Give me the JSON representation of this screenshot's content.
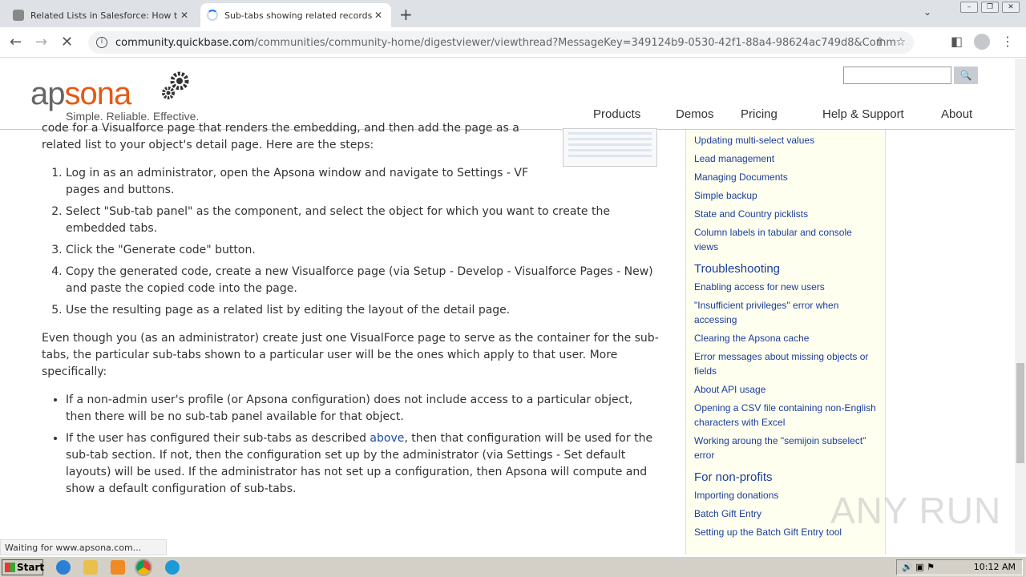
{
  "browser": {
    "tabs": [
      {
        "title": "Related Lists in Salesforce: How to S",
        "active": false
      },
      {
        "title": "Sub-tabs showing related records - /",
        "active": true
      }
    ],
    "url_host": "community.quickbase.com",
    "url_path": "/communities/community-home/digestviewer/viewthread?MessageKey=349124b9-0530-42f1-88a4-98624ac749d8&Communit..."
  },
  "site": {
    "logo_ap": "ap",
    "logo_sona": "sona",
    "tagline": "Simple. Reliable. Effective.",
    "nav": [
      "Products",
      "Demos",
      "Pricing",
      "Help & Support",
      "About"
    ]
  },
  "content": {
    "intro": "code for a Visualforce page that renders the embedding, and then add the page as a related list to your object's detail page. Here are the steps:",
    "steps": [
      "Log in as an administrator, open the Apsona window and navigate to Settings - VF pages and buttons.",
      "Select \"Sub-tab panel\" as the component, and select the object for which you want to create the embedded tabs.",
      "Click the \"Generate code\" button.",
      "Copy the generated code, create a new Visualforce page (via Setup - Develop - Visualforce Pages - New) and paste the copied code into the page.",
      "Use the resulting page as a related list by editing the layout of the detail page."
    ],
    "para2": "Even though you (as an administrator) create just one VisualForce page to serve as the container for the sub-tabs, the particular sub-tabs shown to a particular user will be the ones which apply to that user. More specifically:",
    "bullet1": "If a non-admin user's profile (or Apsona configuration) does not include access to a particular object, then there will be no sub-tab panel available for that object.",
    "bullet2_pre": "If the user has configured their sub-tabs as described ",
    "bullet2_link": "above",
    "bullet2_post": ", then that configuration will be used for the sub-tab section. If not, then the configuration set up by the administrator (via Settings - Set default layouts) will be used. If the administrator has not set up a configuration, then Apsona will compute and show a default configuration of sub-tabs."
  },
  "sidebar": {
    "links_top": [
      "Updating multi-select values",
      "Lead management",
      "Managing Documents",
      "Simple backup",
      "State and Country picklists",
      "Column labels in tabular and console views"
    ],
    "head_trouble": "Troubleshooting",
    "links_trouble": [
      "Enabling access for new users",
      "\"Insufficient privileges\" error when accessing",
      "Clearing the Apsona cache",
      "Error messages about missing objects or fields",
      "About API usage",
      "Opening a CSV file containing non-English characters with Excel",
      "Working aroung the \"semijoin subselect\" error"
    ],
    "head_np": "For non-profits",
    "links_np": [
      "Importing donations",
      "Batch Gift Entry",
      "Setting up the Batch Gift Entry tool"
    ]
  },
  "status_text": "Waiting for www.apsona.com...",
  "watermark": "ANY RUN",
  "taskbar": {
    "start": "Start",
    "clock": "10:12 AM"
  }
}
